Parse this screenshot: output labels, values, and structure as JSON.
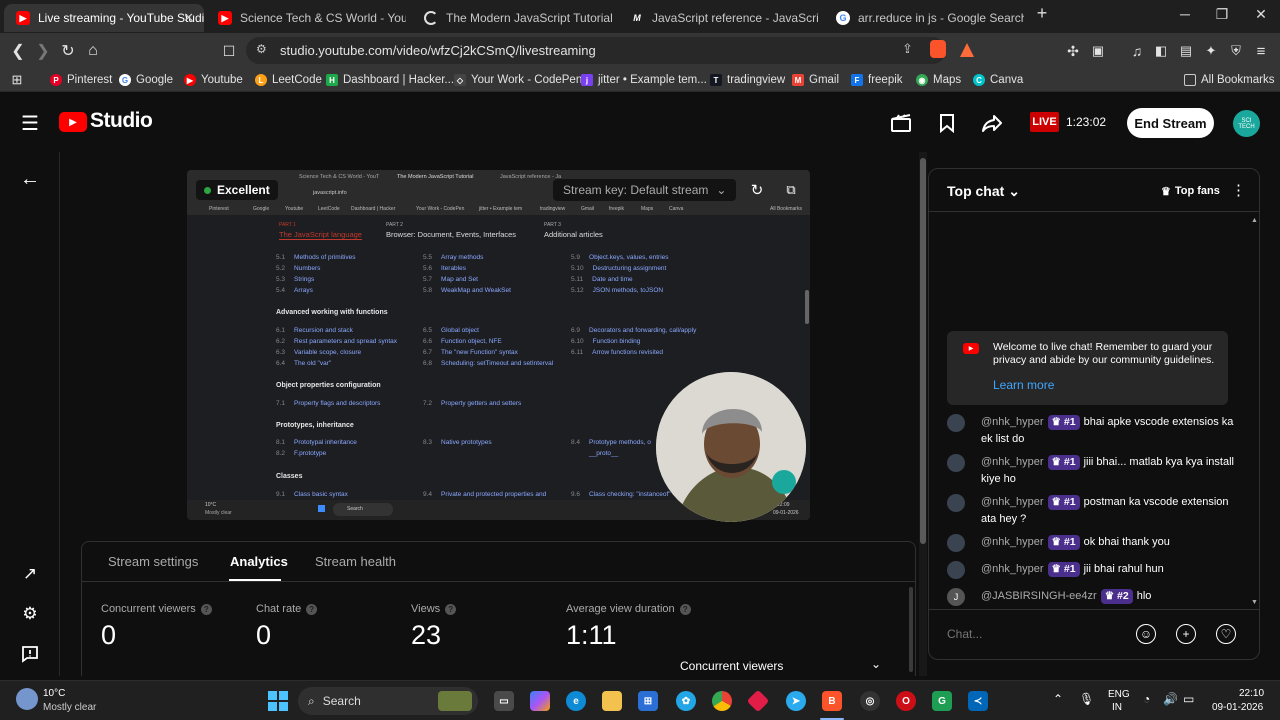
{
  "browser": {
    "tabs": [
      {
        "title": "Live streaming - YouTube Studio",
        "active": true
      },
      {
        "title": "Science Tech & CS World - YouTube"
      },
      {
        "title": "The Modern JavaScript Tutorial"
      },
      {
        "title": "JavaScript reference - JavaScript | MD"
      },
      {
        "title": "arr.reduce in js - Google Search"
      }
    ],
    "url": "studio.youtube.com/video/wfzCj2kCSmQ/livestreaming",
    "bookmarks": [
      "Pinterest",
      "Google",
      "Youtube",
      "LeetCode",
      "Dashboard | Hacker...",
      "Your Work - CodePen",
      "jitter • Example tem...",
      "tradingview",
      "Gmail",
      "freepik",
      "Maps",
      "Canva"
    ],
    "all_bookmarks": "All Bookmarks"
  },
  "studio": {
    "logo": "Studio",
    "live_label": "LIVE",
    "live_time": "1:23:02",
    "end_stream": "End Stream",
    "avatar_text": "SCI TECH"
  },
  "preview": {
    "quality": "Excellent",
    "stream_key": "Stream key: Default stream",
    "inner_tabs": [
      "Science Tech & CS World - YouT",
      "The Modern JavaScript Tutorial",
      "JavaScript reference - Ja"
    ],
    "inner_bookmarks": [
      "Pinterest",
      "Google",
      "Youtube",
      "LeetCode",
      "Dashboard | Hacker",
      "Your Work - CodePen",
      "jitter • Example tem",
      "tradingview",
      "Gmail",
      "freepik",
      "Maps",
      "Canva",
      "All Bookmarks"
    ],
    "inner_url": "javascript.info",
    "parts": [
      {
        "part": "PART 1",
        "title": "The JavaScript language"
      },
      {
        "part": "PART 2",
        "title": "Browser: Document, Events, Interfaces"
      },
      {
        "part": "PART 3",
        "title": "Additional articles"
      }
    ],
    "rows": [
      [
        [
          "5.1",
          "Methods of primitives"
        ],
        [
          "5.5",
          "Array methods"
        ],
        [
          "5.9",
          "Object.keys, values, entries"
        ]
      ],
      [
        [
          "5.2",
          "Numbers"
        ],
        [
          "5.6",
          "Iterables"
        ],
        [
          "5.10",
          "Destructuring assignment"
        ]
      ],
      [
        [
          "5.3",
          "Strings"
        ],
        [
          "5.7",
          "Map and Set"
        ],
        [
          "5.11",
          "Date and time"
        ]
      ],
      [
        [
          "5.4",
          "Arrays"
        ],
        [
          "5.8",
          "WeakMap and WeakSet"
        ],
        [
          "5.12",
          "JSON methods, toJSON"
        ]
      ]
    ],
    "section_adv": "Advanced working with functions",
    "adv_rows": [
      [
        [
          "6.1",
          "Recursion and stack"
        ],
        [
          "6.5",
          "Global object"
        ],
        [
          "6.9",
          "Decorators and forwarding, call/apply"
        ]
      ],
      [
        [
          "6.2",
          "Rest parameters and spread syntax"
        ],
        [
          "6.6",
          "Function object, NFE"
        ],
        [
          "6.10",
          "Function binding"
        ]
      ],
      [
        [
          "6.3",
          "Variable scope, closure"
        ],
        [
          "6.7",
          "The \"new Function\" syntax"
        ],
        [
          "6.11",
          "Arrow functions revisited"
        ]
      ],
      [
        [
          "6.4",
          "The old \"var\""
        ],
        [
          "6.8",
          "Scheduling: setTimeout and setInterval"
        ],
        [
          "",
          ""
        ]
      ]
    ],
    "section_obj": "Object properties configuration",
    "obj_row": [
      [
        "7.1",
        "Property flags and descriptors"
      ],
      [
        "7.2",
        "Property getters and setters"
      ]
    ],
    "section_proto": "Prototypes, inheritance",
    "proto_rows": [
      [
        [
          "8.1",
          "Prototypal inheritance"
        ],
        [
          "8.3",
          "Native prototypes"
        ],
        [
          "8.4",
          "Prototype methods, o"
        ]
      ],
      [
        [
          "8.2",
          "F.prototype"
        ],
        [
          "",
          ""
        ],
        [
          "",
          "__proto__"
        ]
      ]
    ],
    "section_classes": "Classes",
    "classes_row": [
      [
        "9.1",
        "Class basic syntax"
      ],
      [
        "9.4",
        "Private and protected properties and"
      ],
      [
        "9.6",
        "Class checking: \"instanceof\""
      ]
    ],
    "inner_weather": "10°C",
    "inner_weather_desc": "Mostly clear",
    "inner_search": "Search",
    "inner_time": "22:09",
    "inner_date": "09-01-2026"
  },
  "panel": {
    "tabs": [
      "Stream settings",
      "Analytics",
      "Stream health"
    ],
    "active_tab": "Analytics",
    "metrics": [
      {
        "label": "Concurrent viewers",
        "value": "0"
      },
      {
        "label": "Chat rate",
        "value": "0"
      },
      {
        "label": "Views",
        "value": "23"
      },
      {
        "label": "Average view duration",
        "value": "1:11"
      }
    ],
    "chart_heading": "Concurrent viewers"
  },
  "chat": {
    "title": "Top chat",
    "top_fans": "Top fans",
    "welcome": "Welcome to live chat! Remember to guard your privacy and abide by our community guidelines.",
    "learn_more": "Learn more",
    "messages": [
      {
        "author": "@nhk_hyper",
        "badge": "#1",
        "text": "bhai apke vscode extensios ka ek list do"
      },
      {
        "author": "@nhk_hyper",
        "badge": "#1",
        "text": "jiii bhai... matlab kya kya install kiye ho"
      },
      {
        "author": "@nhk_hyper",
        "badge": "#1",
        "text": "postman ka vscode extension ata hey ?"
      },
      {
        "author": "@nhk_hyper",
        "badge": "#1",
        "text": "ok bhai thank you"
      },
      {
        "author": "@nhk_hyper",
        "badge": "#1",
        "text": "jii bhai rahul hun"
      },
      {
        "author": "@JASBIRSINGH-ee4zr",
        "badge": "#2",
        "text": "hlo",
        "initial": "J"
      }
    ],
    "placeholder": "Chat..."
  },
  "taskbar": {
    "weather_temp": "10°C",
    "weather_desc": "Mostly clear",
    "search": "Search",
    "lang": "ENG",
    "lang_region": "IN",
    "time": "22:10",
    "date": "09-01-2026"
  },
  "colors": {
    "accent_red": "#cc0000",
    "link_blue": "#3ea6ff",
    "badge_purple": "#4a2f8c",
    "excellent_green": "#2ba640"
  }
}
